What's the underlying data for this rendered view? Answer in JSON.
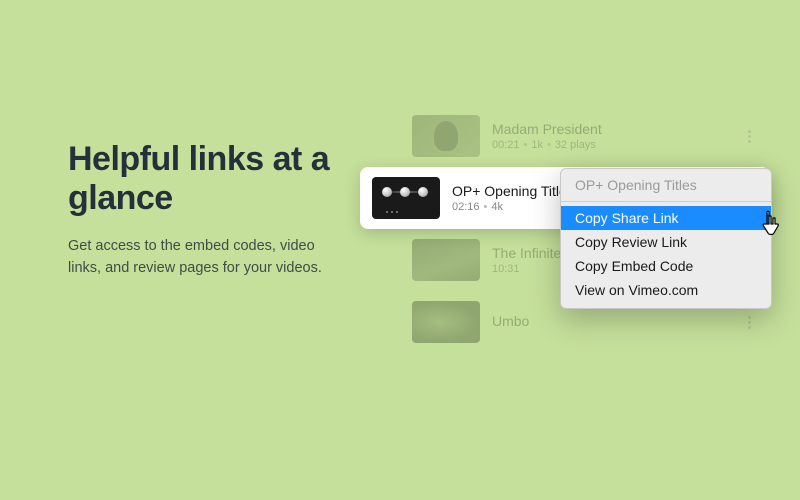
{
  "hero": {
    "title": "Helpful links at a glance",
    "description": "Get access to the embed codes, video links, and review pages for your videos."
  },
  "videos": [
    {
      "title": "Madam President",
      "duration": "00:21",
      "quality": "1k",
      "plays": "32 plays"
    },
    {
      "title": "OP+ Opening Titles",
      "duration": "02:16",
      "quality": "4k",
      "plays": ""
    },
    {
      "title": "The Infinite Now",
      "duration": "10:31",
      "quality": "",
      "plays": ""
    },
    {
      "title": "Umbo",
      "duration": "",
      "quality": "",
      "plays": ""
    }
  ],
  "menu": {
    "header": "OP+ Opening Titles",
    "items": [
      "Copy Share Link",
      "Copy Review Link",
      "Copy Embed Code",
      "View on Vimeo.com"
    ],
    "highlightedIndex": 0
  }
}
